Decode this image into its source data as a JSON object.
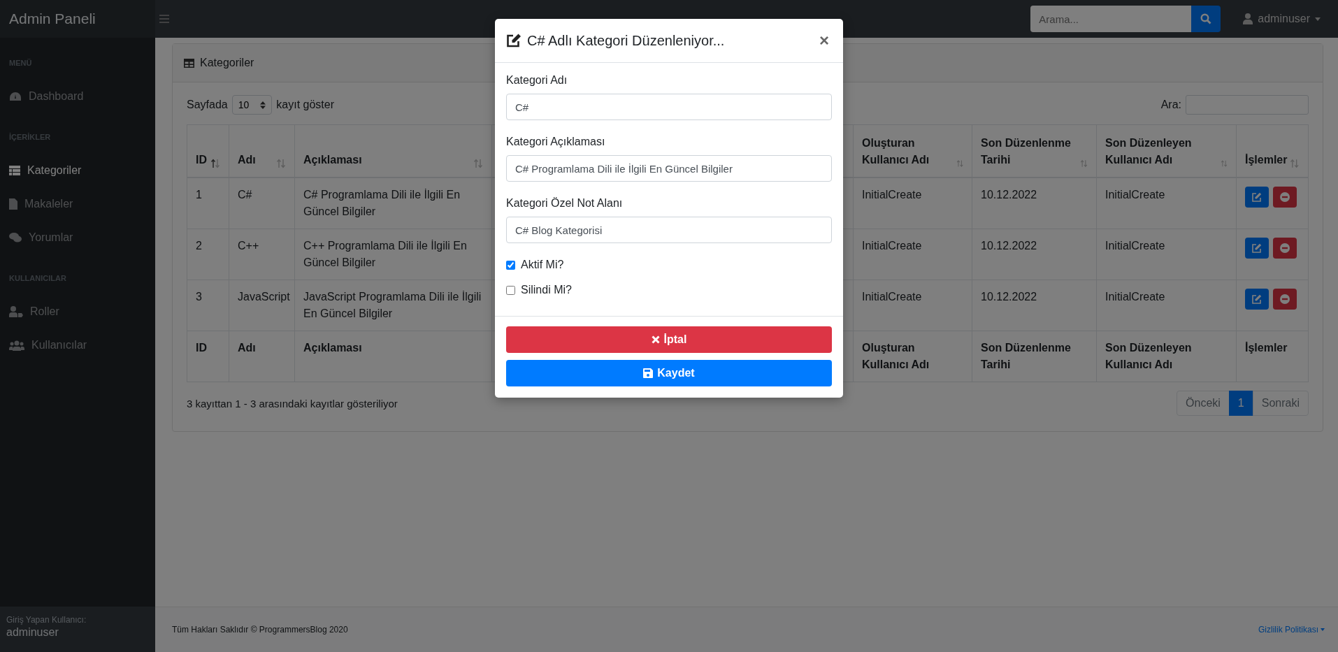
{
  "topbar": {
    "brand": "Admin Paneli",
    "search": {
      "placeholder": "Arama..."
    },
    "user": "adminuser"
  },
  "sidebar": {
    "sections": [
      {
        "heading": "MENÜ",
        "items": [
          {
            "label": "Dashboard",
            "kind": "gauge",
            "selected": false
          }
        ]
      },
      {
        "heading": "İÇERİKLER",
        "items": [
          {
            "label": "Kategoriler",
            "kind": "table",
            "selected": true
          },
          {
            "label": "Makaleler",
            "kind": "file",
            "selected": false
          },
          {
            "label": "Yorumlar",
            "kind": "comments",
            "selected": false
          }
        ]
      },
      {
        "heading": "KULLANICILAR",
        "items": [
          {
            "label": "Roller",
            "kind": "role",
            "selected": false
          },
          {
            "label": "Kullanıcılar",
            "kind": "users",
            "selected": false
          }
        ]
      }
    ],
    "footer": {
      "caption": "Giriş Yapan Kullanıcı:",
      "user": "adminuser"
    }
  },
  "card": {
    "title": "Kategoriler",
    "length_before": "Sayfada",
    "length_value": "10",
    "length_after": "kayıt göster",
    "search_label": "Ara:",
    "table": {
      "columns": [
        {
          "label": "ID",
          "sorted": true
        },
        {
          "label": "Adı",
          "sorted": false
        },
        {
          "label": "Açıklaması",
          "sorted": false
        },
        {
          "label": "Oluşturan Kullanıcı Adı",
          "sorted": false
        },
        {
          "label": "Son Düzenlenme Tarihi",
          "sorted": false
        },
        {
          "label": "Son Düzenleyen Kullanıcı Adı",
          "sorted": false
        },
        {
          "label": "İşlemler",
          "sorted": false
        }
      ],
      "rows": [
        {
          "cells": [
            "1",
            "C#",
            "C# Programlama Dili ile İlgili En Güncel Bilgiler",
            "InitialCreate",
            "10.12.2022",
            "InitialCreate"
          ]
        },
        {
          "cells": [
            "2",
            "C++",
            "C++ Programlama Dili ile İlgili En Güncel Bilgiler",
            "InitialCreate",
            "10.12.2022",
            "InitialCreate"
          ]
        },
        {
          "cells": [
            "3",
            "JavaScript",
            "JavaScript Programlama Dili ile İlgili En Güncel Bilgiler",
            "InitialCreate",
            "10.12.2022",
            "InitialCreate"
          ]
        }
      ],
      "footer": [
        "ID",
        "Adı",
        "Açıklaması",
        "Oluşturan Kullanıcı Adı",
        "Son Düzenlenme Tarihi",
        "Son Düzenleyen Kullanıcı Adı",
        "İşlemler"
      ]
    },
    "info": "3 kayıttan 1 - 3 arasındaki kayıtlar gösteriliyor",
    "pagination": [
      {
        "label": "Önceki",
        "selected": false
      },
      {
        "label": "1",
        "selected": true
      },
      {
        "label": "Sonraki",
        "selected": false
      }
    ]
  },
  "footer": {
    "copyright": "Tüm Hakları Saklıdır © ProgrammersBlog 2020",
    "link": "Gizlilik Politikası"
  },
  "modal": {
    "title": "C# Adlı Kategori Düzenleniyor...",
    "close": "×",
    "fields": [
      {
        "label": "Kategori Adı",
        "value": "C#"
      },
      {
        "label": "Kategori Açıklaması",
        "value": "C# Programlama Dili ile İlgili En Güncel Bilgiler"
      },
      {
        "label": "Kategori Özel Not Alanı",
        "value": "C# Blog Kategorisi"
      }
    ],
    "checkboxes": [
      {
        "label": "Aktif Mi?",
        "checked": true
      },
      {
        "label": "Silindi Mi?",
        "checked": false
      }
    ],
    "buttons": [
      {
        "label": "İptal",
        "kind": "cancel"
      },
      {
        "label": "Kaydet",
        "kind": "save"
      }
    ]
  }
}
